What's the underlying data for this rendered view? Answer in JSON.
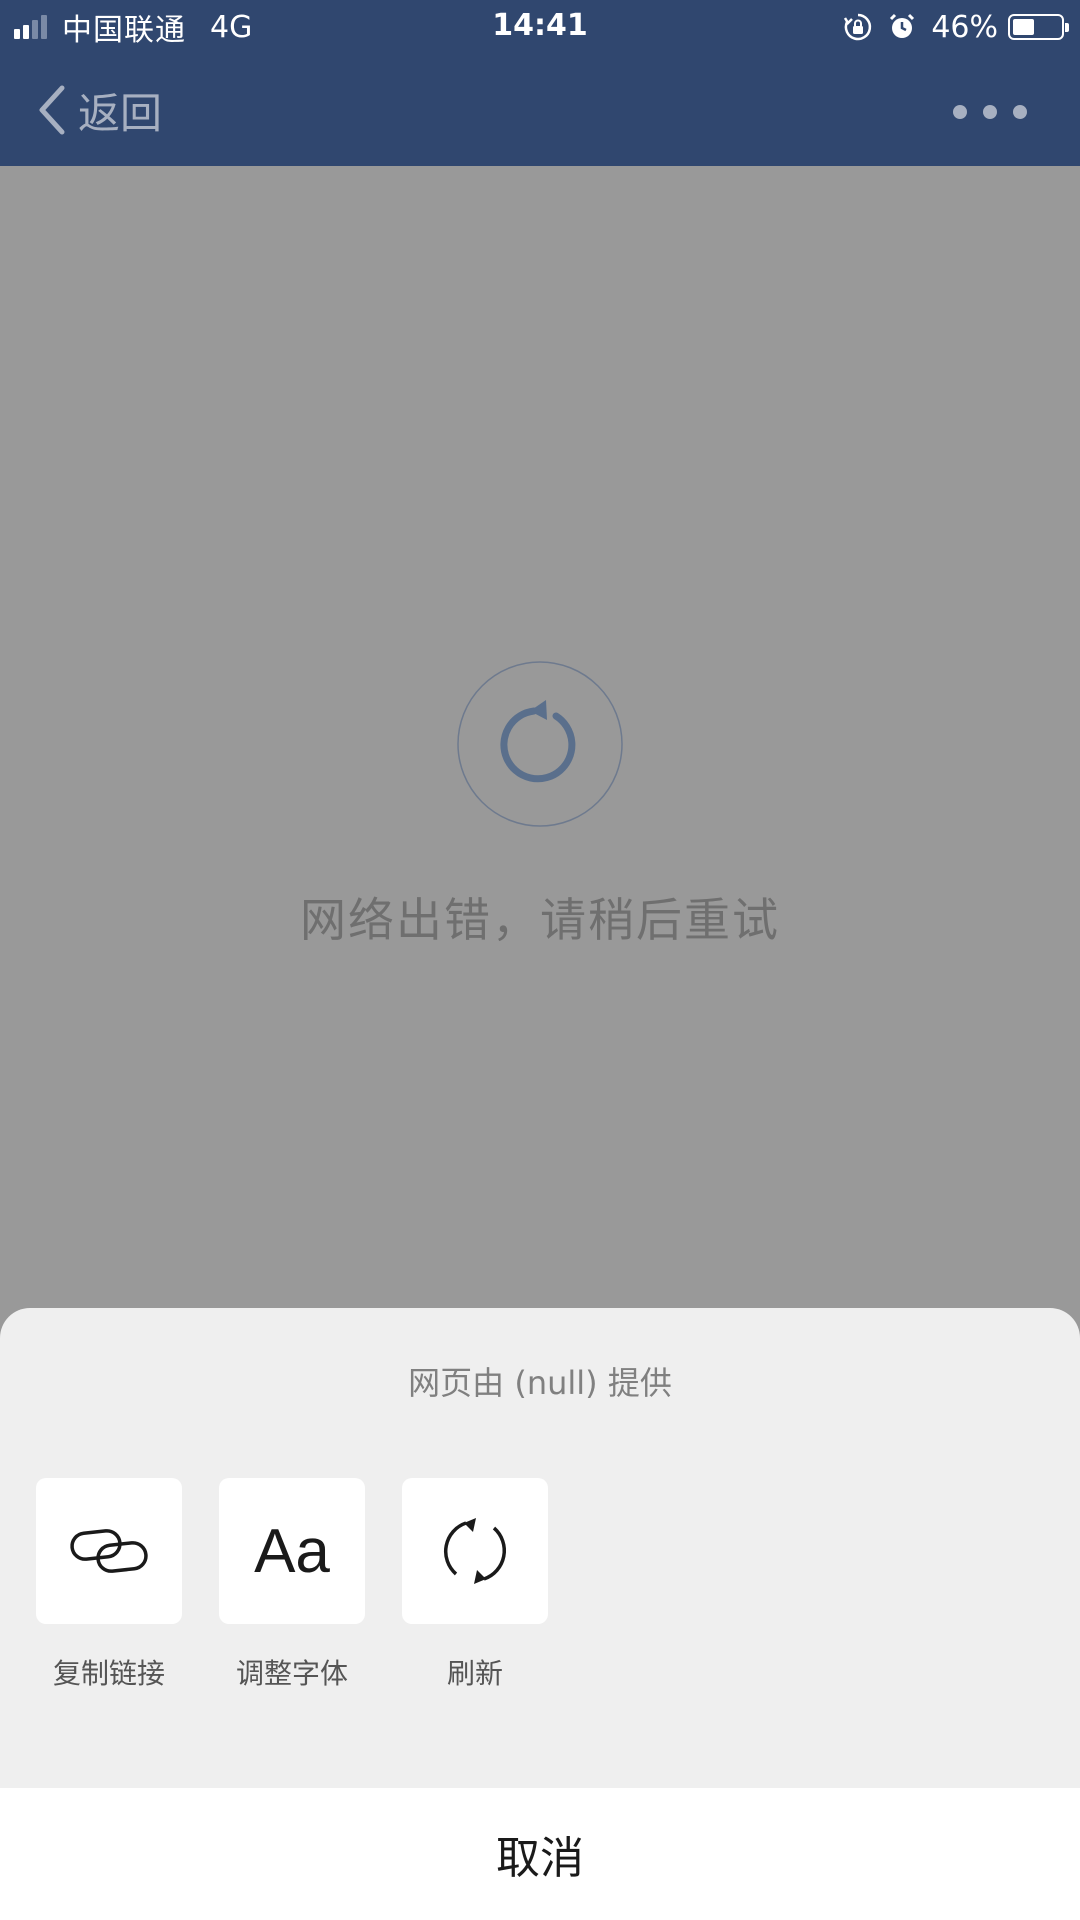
{
  "status_bar": {
    "carrier": "中国联通",
    "network": "4G",
    "time": "14:41",
    "battery_percent_label": "46%",
    "battery_level": 0.46,
    "signal_bars_filled": 2,
    "signal_bars_total": 4,
    "icons": [
      "orientation-lock-icon",
      "alarm-icon"
    ]
  },
  "nav": {
    "back_label": "返回",
    "back_icon": "chevron-left-icon",
    "more_icon": "more-dots-icon"
  },
  "error": {
    "icon": "reload-icon",
    "message": "网络出错，请稍后重试"
  },
  "sheet": {
    "provider_text": "网页由 (null) 提供",
    "actions": [
      {
        "label": "复制链接",
        "icon": "link-icon"
      },
      {
        "label": "调整字体",
        "icon": "font-size-icon",
        "glyph": "Aa"
      },
      {
        "label": "刷新",
        "icon": "refresh-icon"
      }
    ],
    "cancel_label": "取消"
  },
  "colors": {
    "header_bg": "#30476f",
    "overlay_bg": "#999999",
    "sheet_bg": "#efefef",
    "reload_accent": "#5a6f8c"
  }
}
